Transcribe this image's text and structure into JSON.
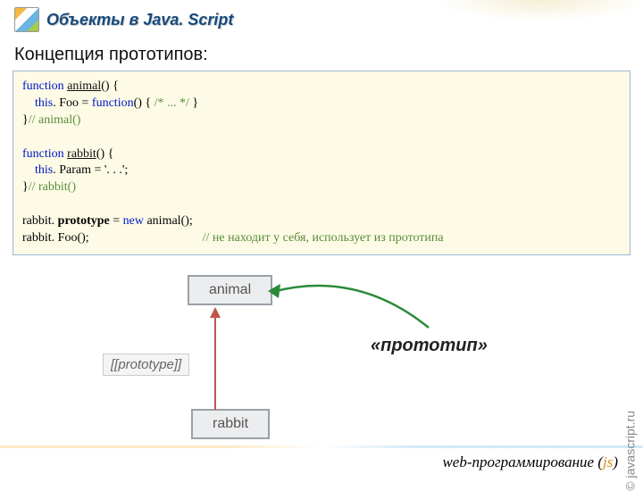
{
  "title": "Объекты в Java. Script",
  "subtitle": "Концепция прототипов:",
  "code": {
    "l1": {
      "a": "function ",
      "b": "animal",
      "c": "() {"
    },
    "l2": {
      "a": "this",
      "b": ". Foo = ",
      "c": "function",
      "d": "() { ",
      "e": "/* ... */",
      "f": " }"
    },
    "l3": {
      "a": "}",
      "b": "// animal()"
    },
    "l4": {
      "a": "function ",
      "b": "rabbit",
      "c": "() {"
    },
    "l5": {
      "a": "this",
      "b": ". Param = '. . .';"
    },
    "l6": {
      "a": "}",
      "b": "// rabbit()"
    },
    "l7": {
      "a": "rabbit. ",
      "b": "prototype",
      "c": " = ",
      "d": "new ",
      "e": "animal();"
    },
    "l8": {
      "a": "rabbit. Foo();",
      "b": "// не находит у себя, использует из прототипа"
    }
  },
  "diagram": {
    "top": "animal",
    "bottom": "rabbit",
    "slot": "[[prototype]]",
    "caption": "«прототип»"
  },
  "copyright": "© javascript.ru",
  "footer": {
    "a": "web-программирование (",
    "b": "js",
    "c": ")"
  }
}
